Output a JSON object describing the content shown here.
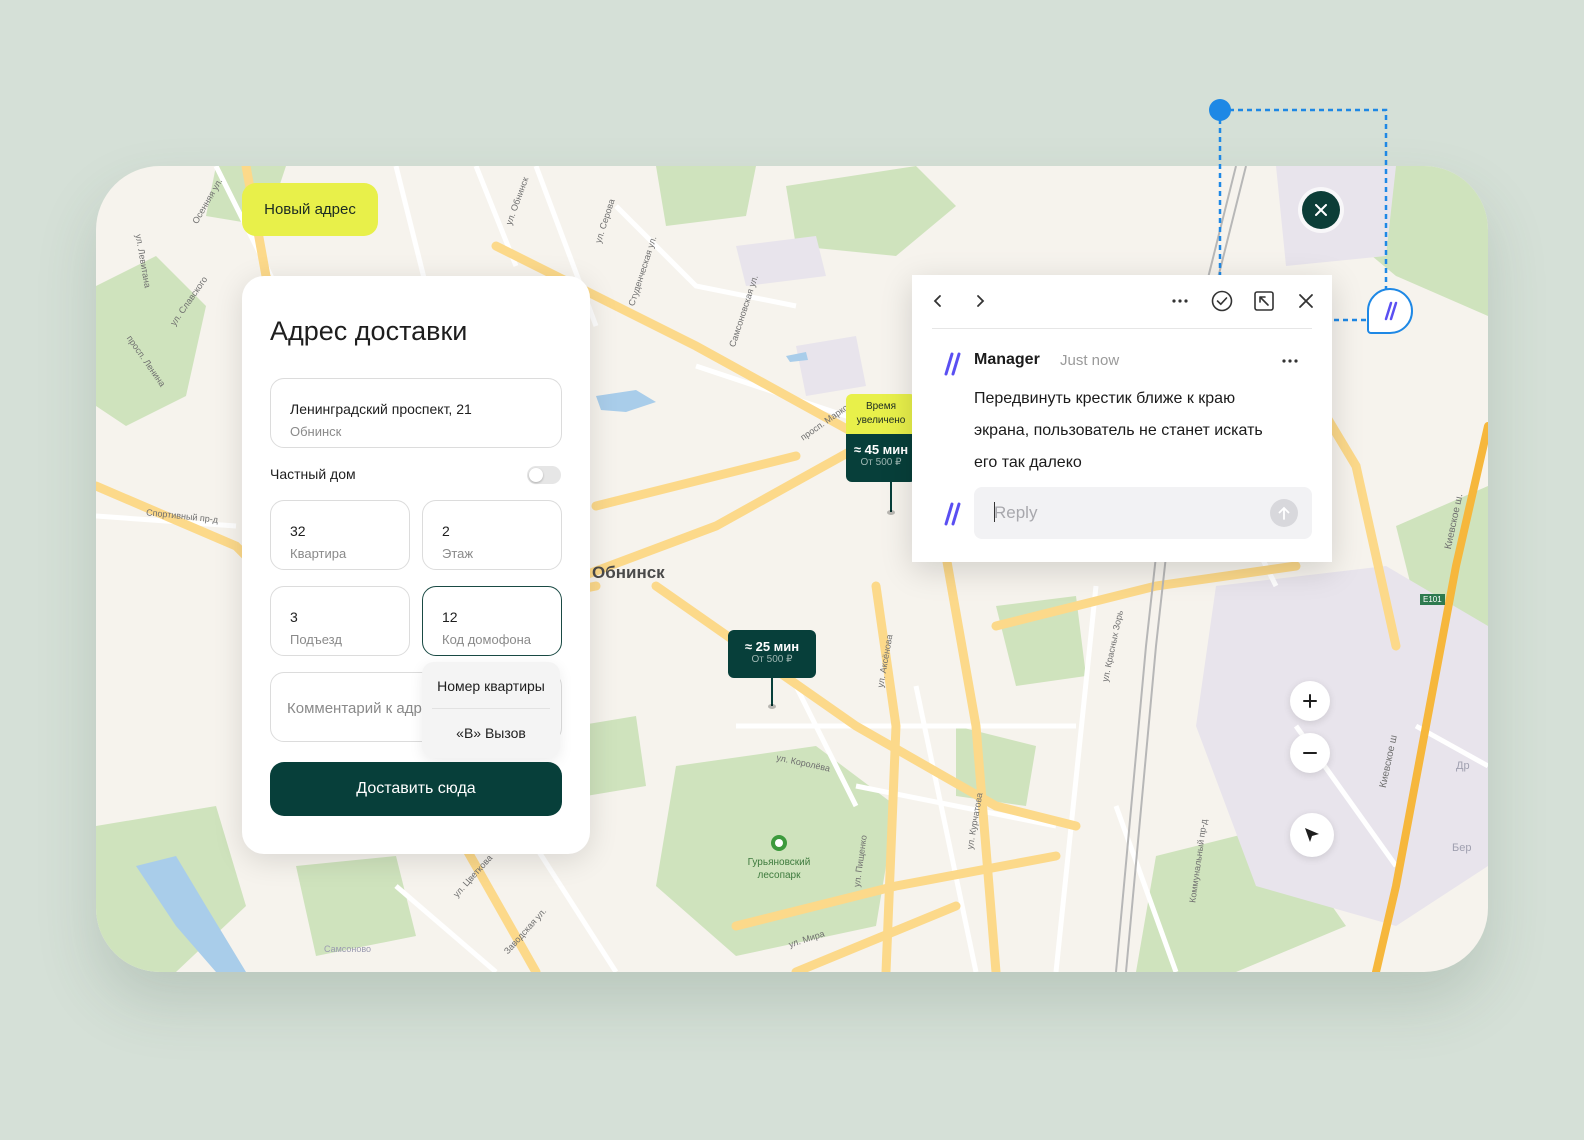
{
  "map": {
    "city": "Обнинск",
    "park": "Гурьяновский лесопарк",
    "streets": [
      "Осенняя ул.",
      "ул. Обнинск",
      "ул. Серова",
      "Студенческая ул.",
      "Самсоновская ул.",
      "ул. Славского",
      "ул. Левитана",
      "просп. Ленина",
      "Спортивный пр-д",
      "просп. Маркса",
      "ул. Курчатова",
      "ул. Королёва",
      "ул. Аксёнова",
      "ул. Пищенко",
      "ул. Цветкова",
      "Заводская ул.",
      "ул. Мира",
      "Коммунальный пр-д",
      "Киевское ш.",
      "Киевское ш",
      "ул. Красных Зорь",
      "E101",
      "Самсоново",
      "Др",
      "Бер"
    ]
  },
  "badge": {
    "label": "Новый адрес"
  },
  "form": {
    "title": "Адрес доставки",
    "address": {
      "value": "Ленинградский проспект, 21",
      "label": "Обнинск"
    },
    "private_house": {
      "label": "Частный дом",
      "on": false
    },
    "apartment": {
      "value": "32",
      "label": "Квартира"
    },
    "floor": {
      "value": "2",
      "label": "Этаж"
    },
    "entrance": {
      "value": "3",
      "label": "Подъезд"
    },
    "intercom": {
      "value": "12",
      "label": "Код домофона"
    },
    "comment_placeholder": "Комментарий к адресу",
    "dropdown": [
      "Номер квартиры",
      "«В» Вызов"
    ],
    "submit": "Доставить сюда"
  },
  "pins": [
    {
      "time": "≈ 25 мин",
      "price": "От 500 ₽"
    },
    {
      "time": "≈ 45 мин",
      "price": "От 500 ₽",
      "note": "Время увеличено"
    }
  ],
  "comment": {
    "author": "Manager",
    "time": "Just now",
    "text": "Передвинуть крестик ближе к краю экрана, пользователь не станет искать его так далеко",
    "reply_placeholder": "Reply"
  },
  "colors": {
    "accent": "#073f3a",
    "badge": "#e8f04a",
    "selection": "#1e88e5",
    "comment_logo": "#5a4ff2"
  }
}
